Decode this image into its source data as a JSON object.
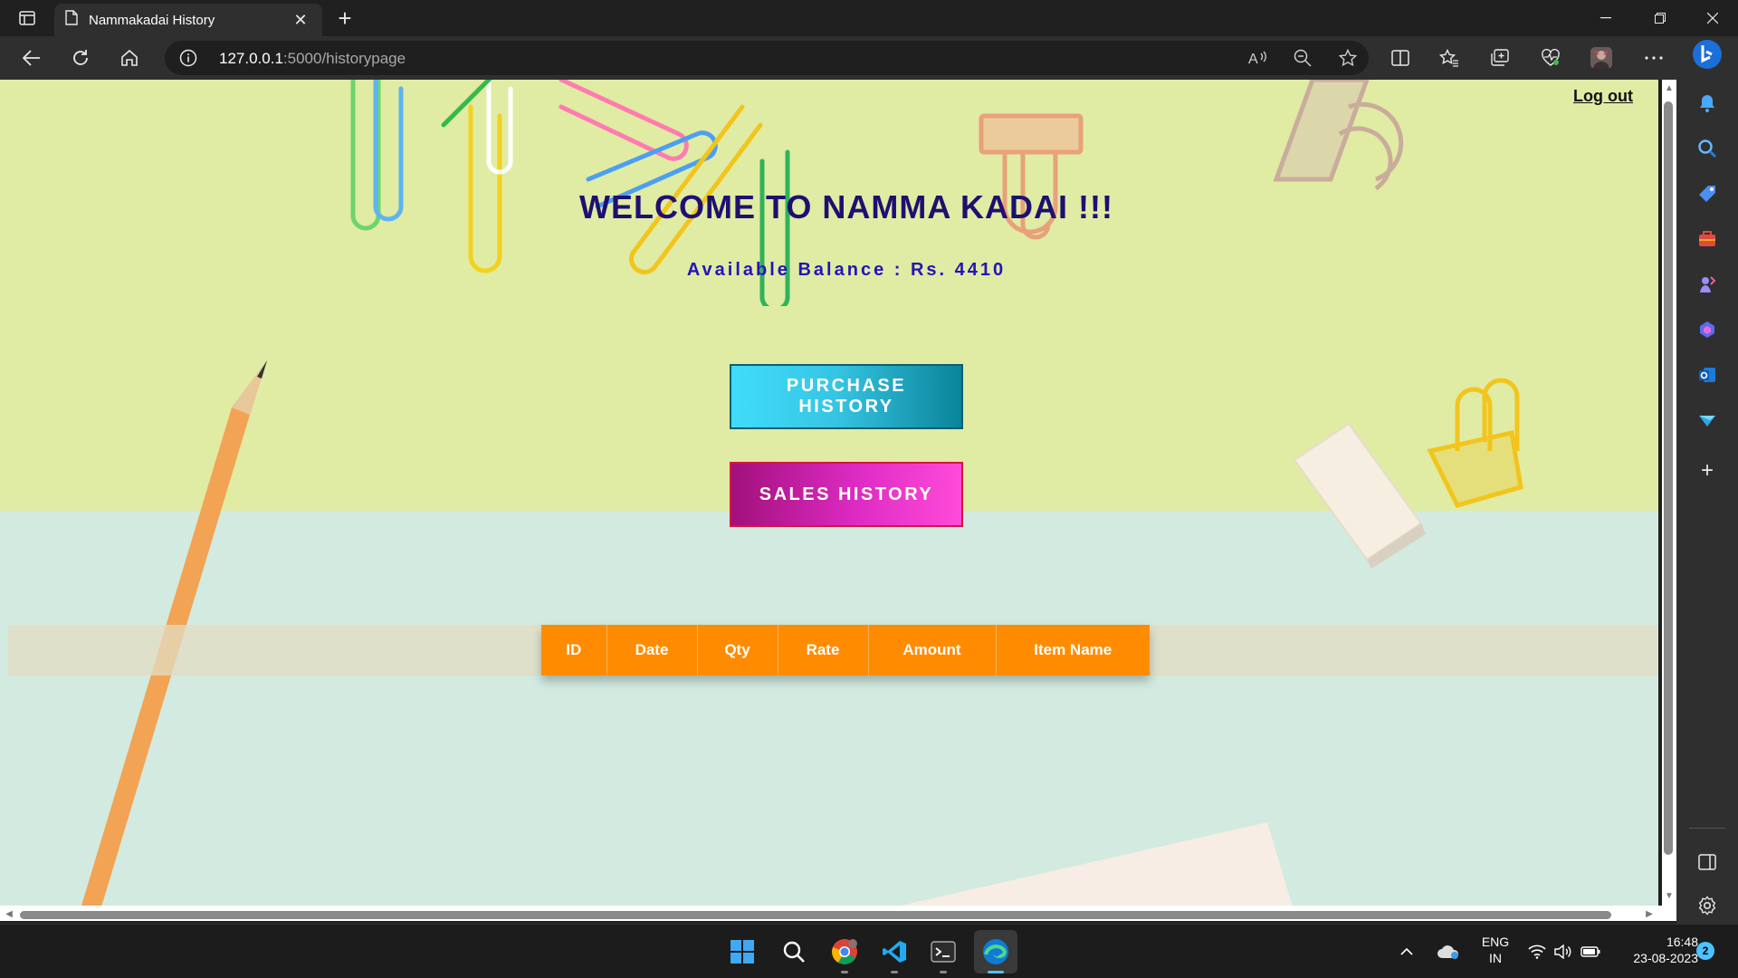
{
  "browser": {
    "tab_title": "Nammakadai History",
    "url_host": "127.0.0.1",
    "url_path": ":5000/historypage"
  },
  "page": {
    "logout_label": "Log out",
    "welcome_title": "WELCOME TO NAMMA KADAI !!!",
    "balance_text": "Available Balance : Rs. 4410",
    "purchase_history_label": "PURCHASE HISTORY",
    "sales_history_label": "SALES HISTORY",
    "table_headers": [
      "ID",
      "Date",
      "Qty",
      "Rate",
      "Amount",
      "Item Name"
    ]
  },
  "taskbar": {
    "lang_line1": "ENG",
    "lang_line2": "IN",
    "time": "16:48",
    "date": "23-08-2023",
    "notification_count": "2"
  },
  "colors": {
    "accent_blue": "#4cc2ff",
    "table_header": "#ff8c00",
    "title_text": "#1e1070"
  }
}
